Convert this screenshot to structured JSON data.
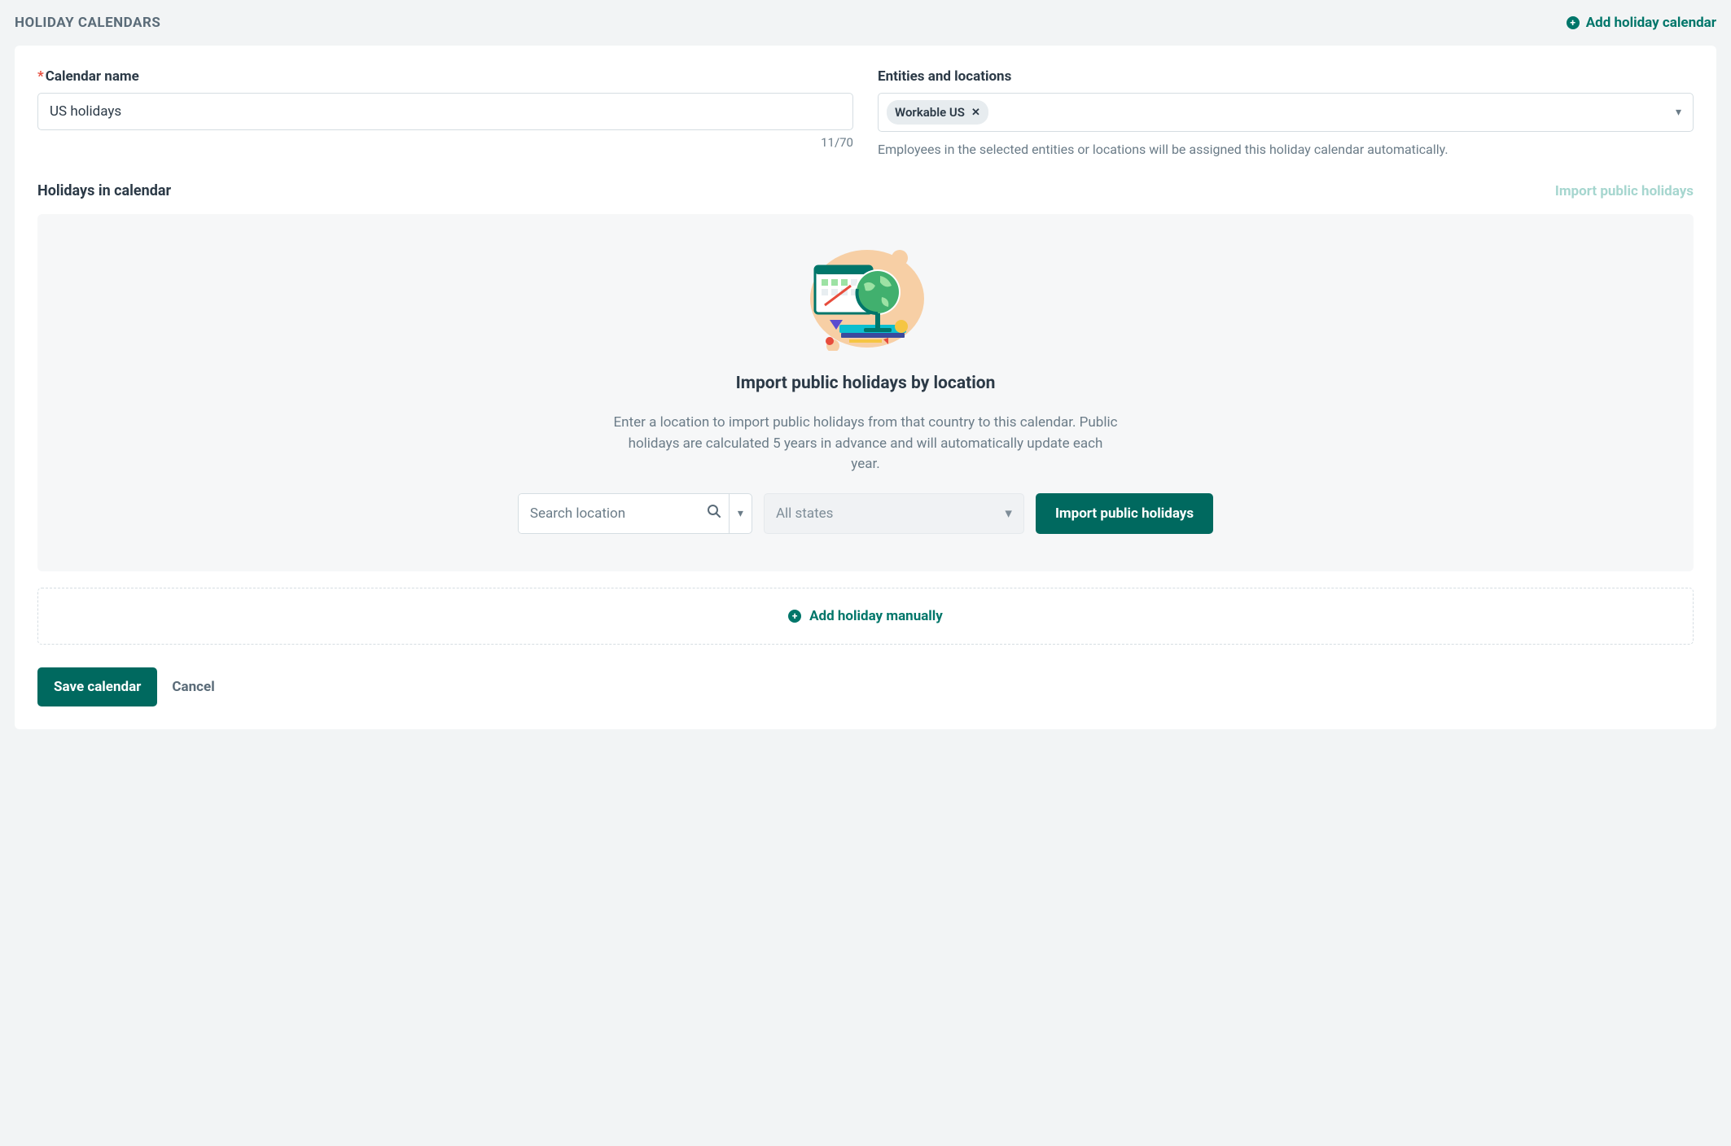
{
  "header": {
    "title": "HOLIDAY CALENDARS",
    "add_link": "Add holiday calendar"
  },
  "form": {
    "name_label": "Calendar name",
    "name_value": "US holidays",
    "name_counter": "11/70",
    "entities_label": "Entities and locations",
    "entities_chip": "Workable US",
    "entities_helper": "Employees in the selected entities or locations will be assigned this holiday calendar automatically."
  },
  "holidays": {
    "section_title": "Holidays in calendar",
    "import_link": "Import public holidays",
    "empty_title": "Import public holidays by location",
    "empty_desc": "Enter a location to import public holidays from that country to this calendar. Public holidays are calculated 5 years in advance and will automatically update each year.",
    "search_placeholder": "Search location",
    "state_select_label": "All states",
    "import_button": "Import public holidays",
    "add_manual": "Add holiday manually"
  },
  "footer": {
    "save": "Save calendar",
    "cancel": "Cancel"
  }
}
